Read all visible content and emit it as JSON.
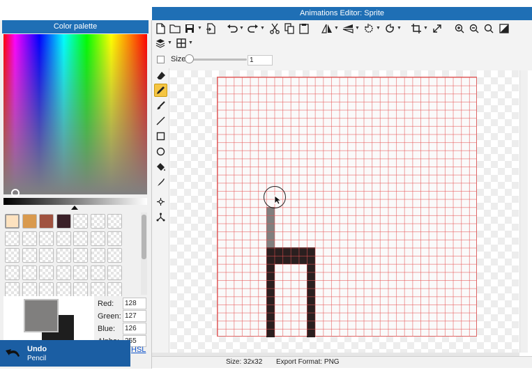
{
  "window": {
    "title": "Animations Editor: Sprite"
  },
  "palette": {
    "title": "Color palette",
    "swatches": [
      "#fde2bf",
      "#d99a4e",
      "#a0523f",
      "#3a2028"
    ]
  },
  "color_editor": {
    "red_label": "Red:",
    "red": "128",
    "green_label": "Green:",
    "green": "127",
    "blue_label": "Blue:",
    "blue": "126",
    "alpha_label": "Alpha:",
    "alpha": "255",
    "hsl_link": "HSL",
    "current_color": "#807f7e",
    "previous_color": "#1e1e1e"
  },
  "undo_toast": {
    "title": "Undo",
    "subtitle": "Pencil"
  },
  "tool_options": {
    "size_label": "Size",
    "size_value": "1",
    "size_fraction": 0.0
  },
  "side_tools": [
    "eraser-icon",
    "pencil-icon",
    "brush-icon",
    "line-icon",
    "rectangle-icon",
    "ellipse-icon",
    "fill-bucket-icon",
    "eyedropper-icon",
    "move-point-icon",
    "vertex-icon"
  ],
  "active_tool": "pencil",
  "status": {
    "size": "Size: 32x32",
    "export_format": "Export Format: PNG"
  },
  "accent_color": "#1f6fb5"
}
